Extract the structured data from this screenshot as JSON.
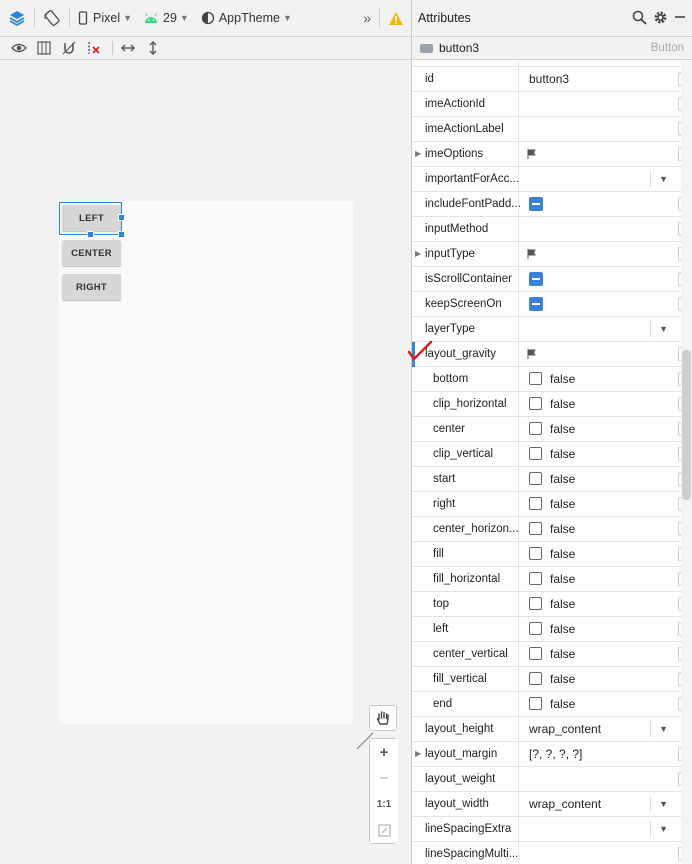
{
  "toolbar": {
    "device_label": "Pixel",
    "api_label": "29",
    "theme_label": "AppTheme",
    "overflow_label": "»"
  },
  "preview": {
    "buttons": [
      {
        "label": "LEFT"
      },
      {
        "label": "CENTER"
      },
      {
        "label": "RIGHT"
      }
    ]
  },
  "zoom": {
    "plus": "+",
    "minus": "−",
    "one_to_one": "1:1"
  },
  "attributes": {
    "title": "Attributes",
    "component_name": "button3",
    "component_type": "Button",
    "rows": [
      {
        "name": "id",
        "kind": "text",
        "value": "button3"
      },
      {
        "name": "imeActionId",
        "kind": "empty"
      },
      {
        "name": "imeActionLabel",
        "kind": "empty"
      },
      {
        "name": "imeOptions",
        "kind": "flag",
        "expandable": true
      },
      {
        "name": "importantForAcc...",
        "kind": "dropdown"
      },
      {
        "name": "includeFontPadd...",
        "kind": "toggle"
      },
      {
        "name": "inputMethod",
        "kind": "empty"
      },
      {
        "name": "inputType",
        "kind": "flag",
        "expandable": true
      },
      {
        "name": "isScrollContainer",
        "kind": "toggle"
      },
      {
        "name": "keepScreenOn",
        "kind": "toggle"
      },
      {
        "name": "layerType",
        "kind": "dropdown"
      },
      {
        "name": "layout_gravity",
        "kind": "flag",
        "expanded": true
      },
      {
        "name": "bottom",
        "kind": "checkbox",
        "value": "false",
        "sub": true
      },
      {
        "name": "clip_horizontal",
        "kind": "checkbox",
        "value": "false",
        "sub": true
      },
      {
        "name": "center",
        "kind": "checkbox",
        "value": "false",
        "sub": true
      },
      {
        "name": "clip_vertical",
        "kind": "checkbox",
        "value": "false",
        "sub": true
      },
      {
        "name": "start",
        "kind": "checkbox",
        "value": "false",
        "sub": true
      },
      {
        "name": "right",
        "kind": "checkbox",
        "value": "false",
        "sub": true
      },
      {
        "name": "center_horizon...",
        "kind": "checkbox",
        "value": "false",
        "sub": true
      },
      {
        "name": "fill",
        "kind": "checkbox",
        "value": "false",
        "sub": true
      },
      {
        "name": "fill_horizontal",
        "kind": "checkbox",
        "value": "false",
        "sub": true
      },
      {
        "name": "top",
        "kind": "checkbox",
        "value": "false",
        "sub": true
      },
      {
        "name": "left",
        "kind": "checkbox",
        "value": "false",
        "sub": true
      },
      {
        "name": "center_vertical",
        "kind": "checkbox",
        "value": "false",
        "sub": true
      },
      {
        "name": "fill_vertical",
        "kind": "checkbox",
        "value": "false",
        "sub": true
      },
      {
        "name": "end",
        "kind": "checkbox",
        "value": "false",
        "sub": true
      },
      {
        "name": "layout_height",
        "kind": "dropdown",
        "value": "wrap_content"
      },
      {
        "name": "layout_margin",
        "kind": "text",
        "value": "[?, ?, ?, ?]",
        "expandable": true
      },
      {
        "name": "layout_weight",
        "kind": "empty"
      },
      {
        "name": "layout_width",
        "kind": "dropdown",
        "value": "wrap_content"
      },
      {
        "name": "lineSpacingExtra",
        "kind": "dropdown"
      },
      {
        "name": "lineSpacingMulti...",
        "kind": "empty"
      }
    ]
  },
  "colors": {
    "accent": "#2a85d8",
    "toggle_blue": "#3b82d6",
    "annotation_red": "#d0201c"
  }
}
